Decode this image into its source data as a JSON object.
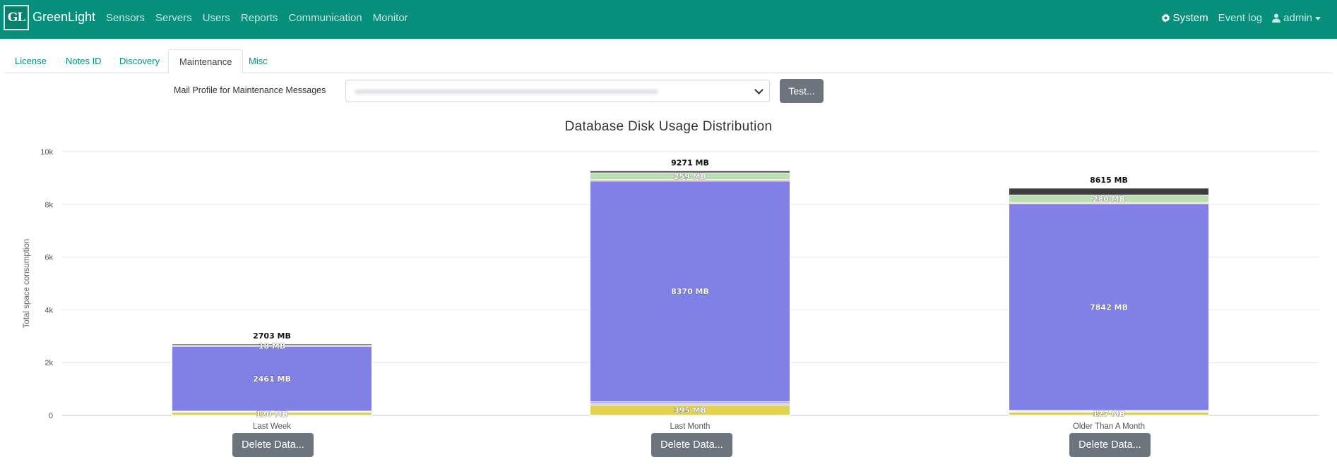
{
  "app": {
    "logo_text": "GL",
    "brand": "GreenLight"
  },
  "nav": {
    "links": [
      "Sensors",
      "Servers",
      "Users",
      "Reports",
      "Communication",
      "Monitor"
    ],
    "system": "System",
    "event_log": "Event log",
    "user": "admin"
  },
  "tabs": [
    "License",
    "Notes ID",
    "Discovery",
    "Maintenance",
    "Misc"
  ],
  "active_tab": "Maintenance",
  "mail_profile": {
    "label": "Mail Profile for Maintenance Messages",
    "test_button": "Test..."
  },
  "colors": {
    "navbar": "#068f7b",
    "purple": "#8080e6",
    "yellow": "#e2d24f",
    "dark": "#3d3d3f",
    "button": "#6c757d"
  },
  "chart_data": {
    "type": "bar",
    "stacked": true,
    "title": "Database Disk Usage Distribution",
    "ylabel": "Total space consumption",
    "ylim": [
      0,
      10000
    ],
    "yticks": [
      "0",
      "2k",
      "4k",
      "6k",
      "8k",
      "10k"
    ],
    "categories": [
      "Last Week",
      "Last Month",
      "Older Than A Month"
    ],
    "totals": [
      "2703 MB",
      "9271 MB",
      "8615 MB"
    ],
    "series": [
      {
        "values": [
          120,
          395,
          127
        ],
        "color": "#e2d24f",
        "labels": [
          "120 MB",
          "395 MB",
          "127 MB"
        ]
      },
      {
        "values": [
          20,
          60,
          30
        ],
        "color": "#c8b8e8",
        "labels": [
          "",
          "",
          ""
        ]
      },
      {
        "values": [
          20,
          60,
          30
        ],
        "color": "#8080e6",
        "labels": [
          "",
          "",
          ""
        ]
      },
      {
        "values": [
          2461,
          8370,
          7842
        ],
        "color": "#8080e6",
        "labels": [
          "2461 MB",
          "8370 MB",
          "7842 MB"
        ]
      },
      {
        "values": [
          10,
          50,
          40
        ],
        "color": "#e07a5f",
        "labels": [
          "",
          "",
          ""
        ]
      },
      {
        "values": [
          18,
          259,
          280
        ],
        "color": "#b9dfb2",
        "labels": [
          "18 MB",
          "259 MB",
          "280 MB"
        ]
      },
      {
        "values": [
          54,
          77,
          266
        ],
        "color": "#3d3d3f",
        "labels": [
          "",
          "",
          ""
        ]
      }
    ]
  },
  "delete_button": "Delete Data..."
}
